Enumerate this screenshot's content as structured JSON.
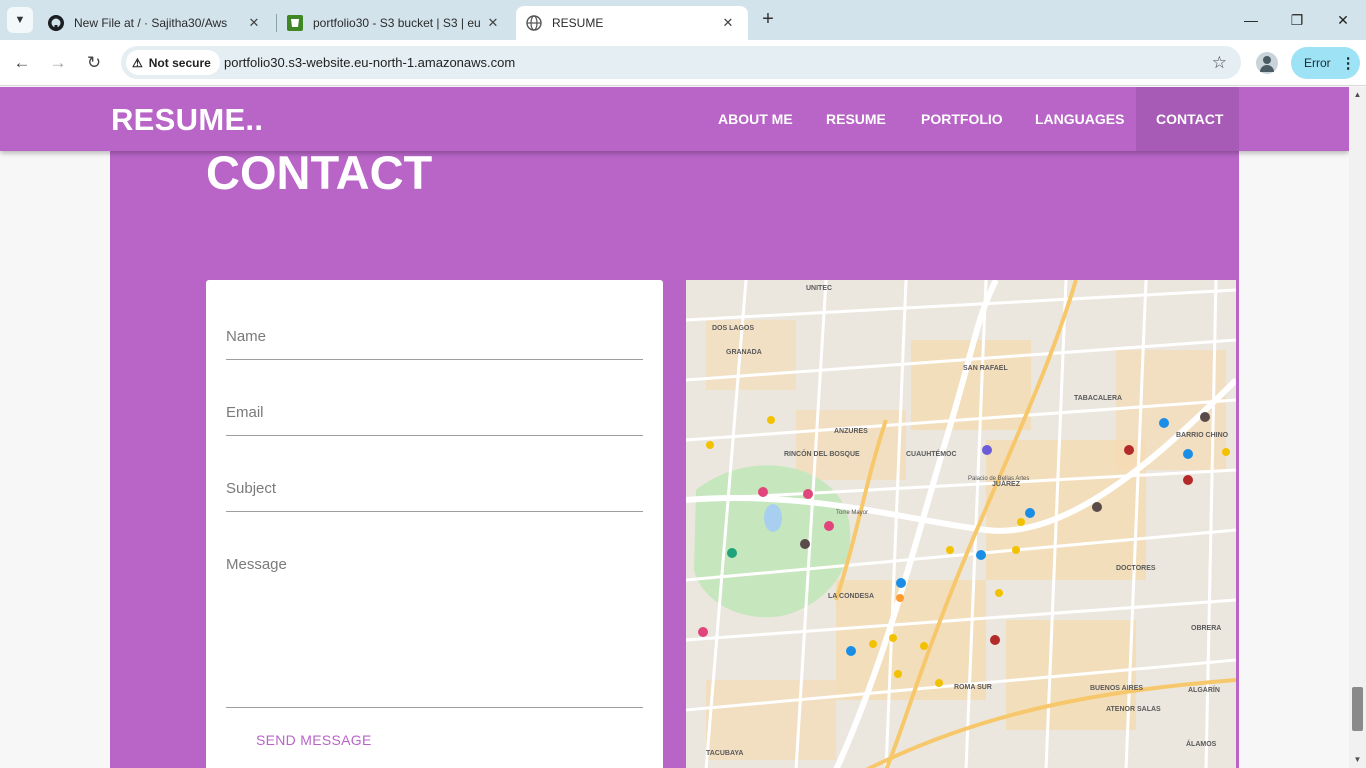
{
  "browser": {
    "tabs": [
      {
        "title": "New File at / · Sajitha30/Aws",
        "icon": "github-icon",
        "active": false
      },
      {
        "title": "portfolio30 - S3 bucket | S3 | eu",
        "icon": "aws-s3-icon",
        "active": false
      },
      {
        "title": "RESUME",
        "icon": "globe-icon",
        "active": true
      }
    ],
    "close_glyph": "✕",
    "new_tab_glyph": "+",
    "security_label": "Not secure",
    "url": "portfolio30.s3-website.eu-north-1.amazonaws.com",
    "error_label": "Error"
  },
  "site": {
    "brand": "RESUME..",
    "nav": [
      {
        "label": "ABOUT ME",
        "active": false
      },
      {
        "label": "RESUME",
        "active": false
      },
      {
        "label": "PORTFOLIO",
        "active": false
      },
      {
        "label": "LANGUAGES",
        "active": false
      },
      {
        "label": "CONTACT",
        "active": true
      }
    ],
    "section_title": "CONTACT",
    "form": {
      "name_placeholder": "Name",
      "email_placeholder": "Email",
      "subject_placeholder": "Subject",
      "message_placeholder": "Message",
      "submit_label": "SEND MESSAGE"
    },
    "map": {
      "labels": [
        "UNITEC",
        "DOS LAGOS",
        "GRANADA",
        "ANZURES",
        "RINCÓN DEL BOSQUE",
        "CUAUHTÉMOC",
        "SAN RAFAEL",
        "TABACALERA",
        "JUÁREZ",
        "BARRIO CHINO",
        "LA CONDESA",
        "DOCTORES",
        "ROMA SUR",
        "BUENOS AIRES",
        "OBRERA",
        "ALGARÍN",
        "TACUBAYA",
        "ATENOR SALAS",
        "ÁLAMOS",
        "Torre Mayor",
        "Palacio de Bellas Artes"
      ]
    }
  },
  "colors": {
    "brand_purple": "#b865c7",
    "nav_active": "#a75ab6",
    "tab_strip": "#d3e3eb",
    "error_button": "#9de2f5"
  }
}
